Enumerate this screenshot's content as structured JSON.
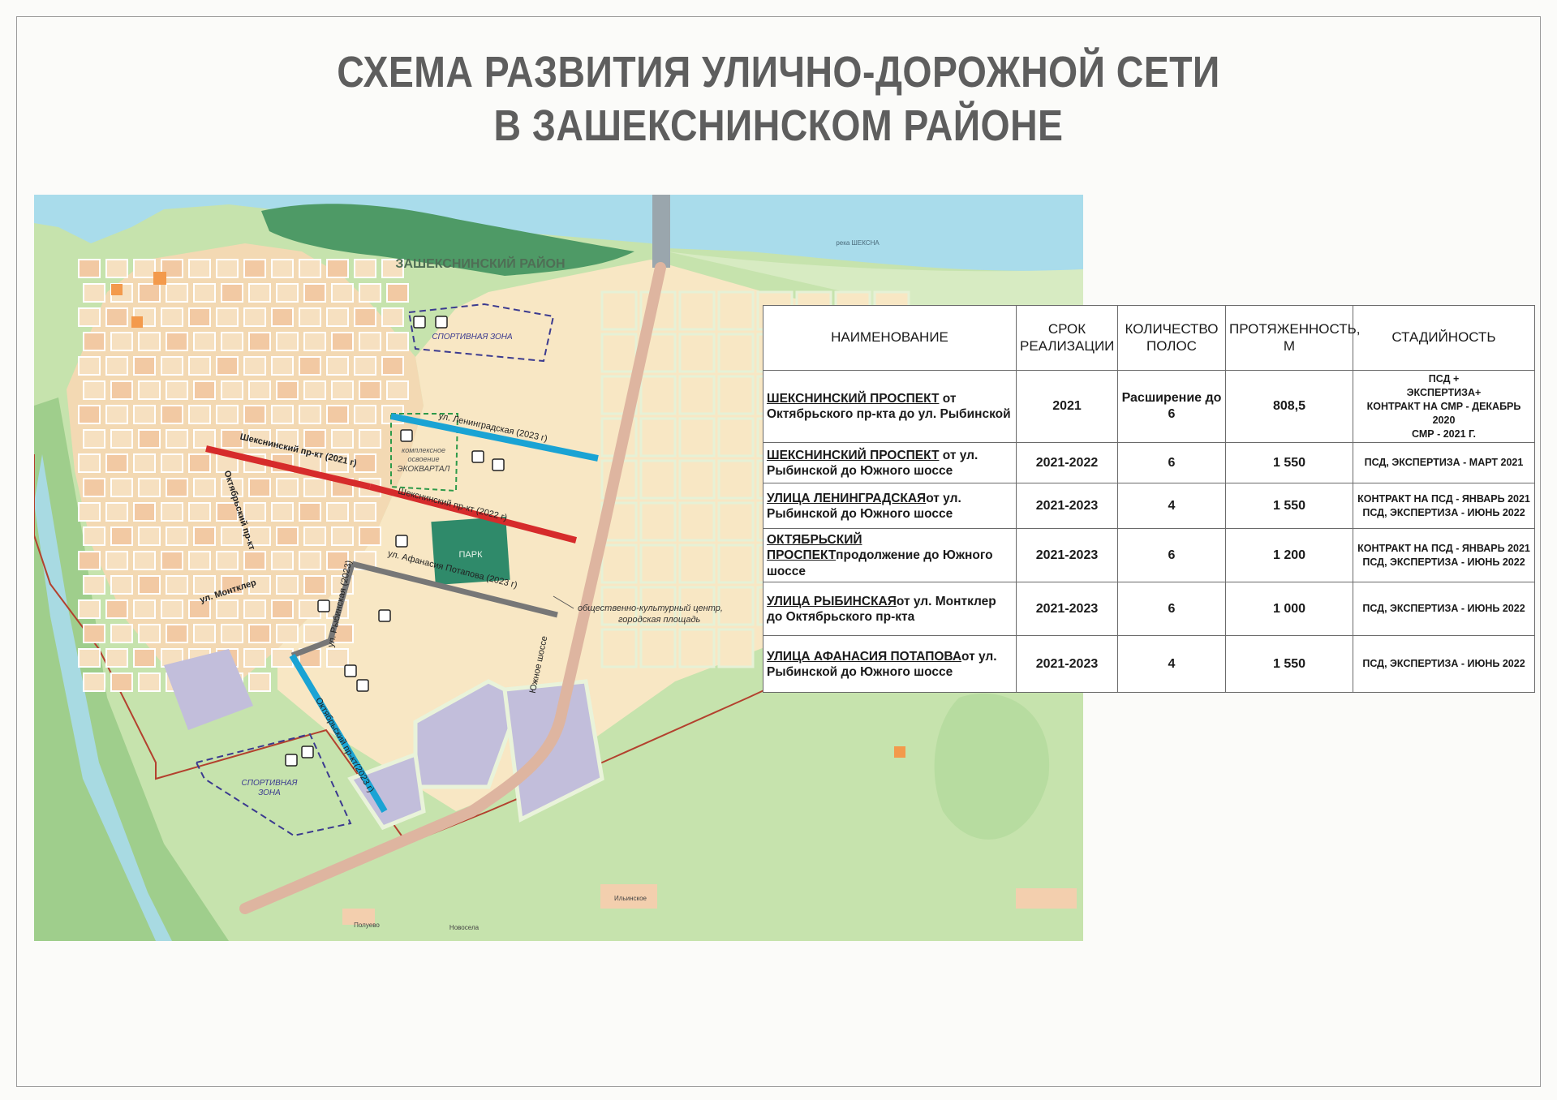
{
  "title": {
    "line1": "СХЕМА РАЗВИТИЯ УЛИЧНО-ДОРОЖНОЙ СЕТИ",
    "line2": "В ЗАШЕКСНИНСКОМ РАЙОНЕ"
  },
  "map": {
    "district_label": "ЗАШЕКСНИНСКИЙ РАЙОН",
    "river_label": "река ШЕКСНА",
    "labels": {
      "sport_zone_top": "СПОРТИВНАЯ ЗОНА",
      "sport_zone_bottom_1": "СПОРТИВНАЯ",
      "sport_zone_bottom_2": "ЗОНА",
      "eco_1": "комплексное",
      "eco_2": "освоение",
      "eco_3": "ЭКОКВАРТАЛ",
      "park": "ПАРК",
      "leningradskaya": "ул. Ленинградская (2023 г)",
      "sheksninsky_2021": "Шекснинский пр-кт (2021 г)",
      "sheksninsky_2022": "Шекснинский пр-кт (2022 г)",
      "afanasiya": "ул. Афанасия Потапова (2023 г)",
      "rybinskaya": "ул. Рыбинская (2023)",
      "oktyabrsky_top": "Октябрьский пр-кт",
      "oktyabrsky_2023": "Октябрьский пр-кт(2023 г)",
      "montkler": "ул. Монтклер",
      "yuzhnoe": "Южное шоссе",
      "cultural_center_1": "общественно-культурный центр,",
      "cultural_center_2": "городская площадь",
      "ilyinskoe": "Ильинское",
      "polyevo": "Полуево",
      "novoselo": "Новосела"
    }
  },
  "table": {
    "headers": [
      "НАИМЕНОВАНИЕ",
      "СРОК РЕАЛИЗАЦИИ",
      "КОЛИЧЕСТВО ПОЛОС",
      "ПРОТЯЖЕННОСТЬ, М",
      "СТАДИЙНОСТЬ"
    ],
    "rows": [
      {
        "name": "ШЕКСНИНСКИЙ ПРОСПЕКТ",
        "desc": " от Октябрьского пр-кта до ул. Рыбинской",
        "term": "2021",
        "lanes": "Расширение до 6",
        "length": "808,5",
        "stage": "ПСД +\nЭКСПЕРТИЗА+\nКОНТРАКТ НА СМР - ДЕКАБРЬ 2020\nСМР - 2021 Г."
      },
      {
        "name": "ШЕКСНИНСКИЙ ПРОСПЕКТ",
        "desc": " от ул. Рыбинской до Южного шоссе",
        "term": "2021-2022",
        "lanes": "6",
        "length": "1 550",
        "stage": "ПСД, ЭКСПЕРТИЗА - МАРТ 2021"
      },
      {
        "name": "УЛИЦА ЛЕНИНГРАДСКАЯ",
        "desc": "от ул. Рыбинской до Южного шоссе",
        "term": "2021-2023",
        "lanes": "4",
        "length": "1 550",
        "stage": "КОНТРАКТ НА ПСД - ЯНВАРЬ 2021\nПСД, ЭКСПЕРТИЗА - ИЮНЬ 2022"
      },
      {
        "name": "ОКТЯБРЬСКИЙ ПРОСПЕКТ",
        "desc": "продолжение до Южного шоссе",
        "term": "2021-2023",
        "lanes": "6",
        "length": "1 200",
        "stage": "КОНТРАКТ НА ПСД - ЯНВАРЬ 2021\nПСД, ЭКСПЕРТИЗА - ИЮНЬ 2022"
      },
      {
        "name": "УЛИЦА РЫБИНСКАЯ",
        "desc": "от ул. Монтклер до Октябрьского пр-кта",
        "term": "2021-2023",
        "lanes": "6",
        "length": "1 000",
        "stage": "ПСД, ЭКСПЕРТИЗА - ИЮНЬ 2022"
      },
      {
        "name": "УЛИЦА АФАНАСИЯ ПОТАПОВА",
        "desc": "от ул. Рыбинской до Южного шоссе",
        "term": "2021-2023",
        "lanes": "4",
        "length": "1 550",
        "stage": "ПСД, ЭКСПЕРТИЗА - ИЮНЬ 2022"
      }
    ]
  },
  "colors": {
    "road_2021_2022": "#d62b2b",
    "road_2023_blue": "#1aa3d4",
    "road_2023_gray": "#777777",
    "yuzhnoe_shosse": "#deb5a0",
    "water": "#a9dceb",
    "park": "#2f8a6a",
    "forest": "#9fce8c",
    "planned_lots": "#f8e7c4",
    "industrial": "#c2bedb",
    "title_gray": "#5e5e5e"
  }
}
